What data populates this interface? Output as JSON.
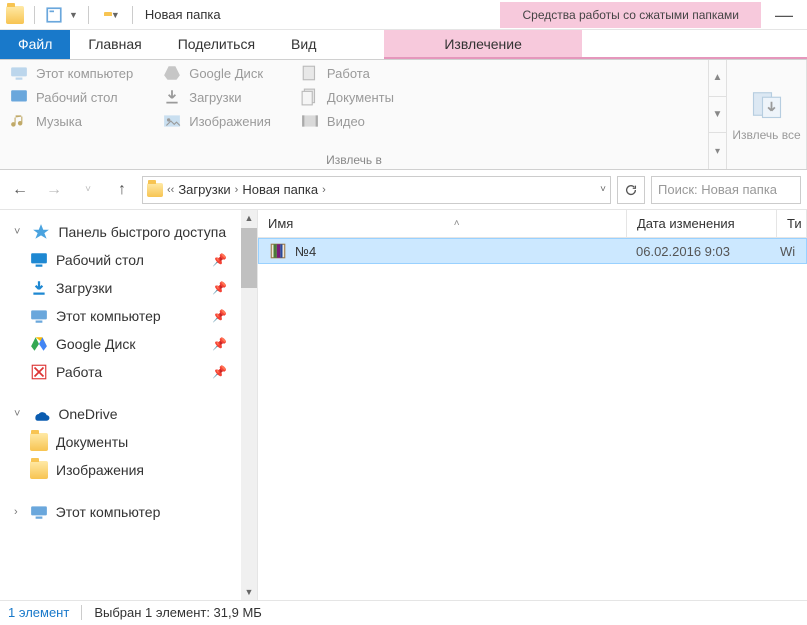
{
  "title": "Новая папка",
  "context_tool_label": "Средства работы со сжатыми папками",
  "tabs": {
    "file": "Файл",
    "home": "Главная",
    "share": "Поделиться",
    "view": "Вид",
    "extract": "Извлечение"
  },
  "ribbon": {
    "extract_to_group": "Извлечь в",
    "destinations": {
      "0": "Этот компьютер",
      "1": "Рабочий стол",
      "2": "Музыка",
      "3": "Google Диск",
      "4": "Загрузки",
      "5": "Изображения",
      "6": "Работа",
      "7": "Документы",
      "8": "Видео"
    },
    "extract_all": "Извлечь все"
  },
  "breadcrumb": {
    "0": "Загрузки",
    "1": "Новая папка"
  },
  "search_placeholder": "Поиск: Новая папка",
  "sidebar": {
    "quick_access": "Панель быстрого доступа",
    "items": {
      "0": "Рабочий стол",
      "1": "Загрузки",
      "2": "Этот компьютер",
      "3": "Google Диск",
      "4": "Работа"
    },
    "onedrive": "OneDrive",
    "od_items": {
      "0": "Документы",
      "1": "Изображения"
    },
    "this_pc": "Этот компьютер"
  },
  "columns": {
    "name": "Имя",
    "date": "Дата изменения",
    "type": "Ти"
  },
  "files": {
    "0": {
      "name": "№4",
      "date": "06.02.2016 9:03",
      "type": "Wi"
    }
  },
  "status": {
    "count": "1 элемент",
    "selection": "Выбран 1 элемент: 31,9 МБ"
  }
}
